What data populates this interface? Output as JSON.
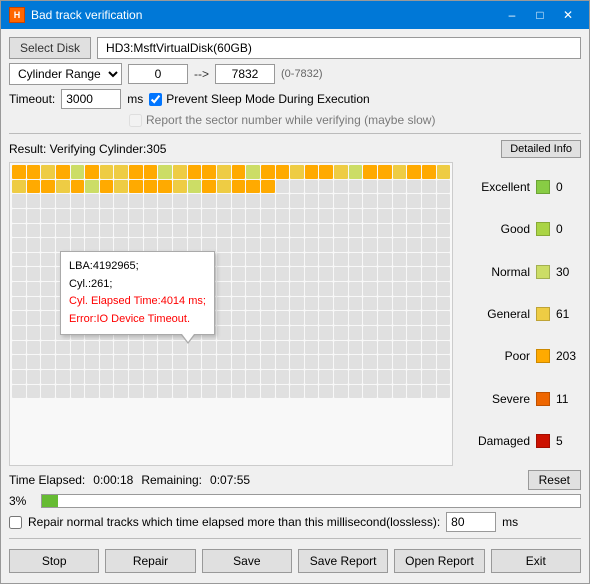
{
  "window": {
    "title": "Bad track verification",
    "icon": "HDD"
  },
  "toolbar": {
    "select_disk_label": "Select Disk",
    "disk_name": "HD3:MsftVirtualDisk(60GB)"
  },
  "range": {
    "type": "Cylinder Range",
    "from": "0",
    "to": "7832",
    "hint": "(0-7832)",
    "arrow": "-->"
  },
  "timeout": {
    "label": "Timeout:",
    "value": "3000",
    "unit": "ms"
  },
  "checkboxes": {
    "prevent_sleep": "Prevent Sleep Mode During Execution",
    "report_sector": "Report the sector number while verifying (maybe slow)"
  },
  "result": {
    "label": "Result: Verifying Cylinder:305",
    "detailed_info_label": "Detailed Info"
  },
  "tooltip": {
    "lba": "LBA:4192965;",
    "cyl": "Cyl.:261;",
    "elapsed": "Cyl. Elapsed Time:4014 ms;",
    "error": "Error:IO Device Timeout."
  },
  "legend": {
    "items": [
      {
        "label": "Excellent",
        "color": "#88cc44",
        "count": "0"
      },
      {
        "label": "Good",
        "color": "#aad444",
        "count": "0"
      },
      {
        "label": "Normal",
        "color": "#ccdd66",
        "count": "30"
      },
      {
        "label": "General",
        "color": "#eecc44",
        "count": "61"
      },
      {
        "label": "Poor",
        "color": "#ffaa00",
        "count": "203"
      },
      {
        "label": "Severe",
        "color": "#ee6600",
        "count": "11"
      },
      {
        "label": "Damaged",
        "color": "#cc1100",
        "count": "5"
      }
    ]
  },
  "time": {
    "elapsed_label": "Time Elapsed:",
    "elapsed_value": "0:00:18",
    "remaining_label": "Remaining:",
    "remaining_value": "0:07:55",
    "reset_label": "Reset"
  },
  "progress": {
    "pct": "3%",
    "value": 3
  },
  "repair": {
    "label": "Repair normal tracks which time elapsed more than this millisecond(lossless):",
    "value": "80",
    "unit": "ms"
  },
  "buttons": {
    "stop": "Stop",
    "repair": "Repair",
    "save": "Save",
    "save_report": "Save Report",
    "open_report": "Open Report",
    "exit": "Exit"
  },
  "grid_colors": {
    "empty": "#e8e8e8",
    "excellent": "#88cc44",
    "good": "#aad444",
    "normal": "#ccdd66",
    "general": "#eecc44",
    "poor": "#ffaa00",
    "severe": "#ee6600",
    "damaged": "#cc1100"
  }
}
